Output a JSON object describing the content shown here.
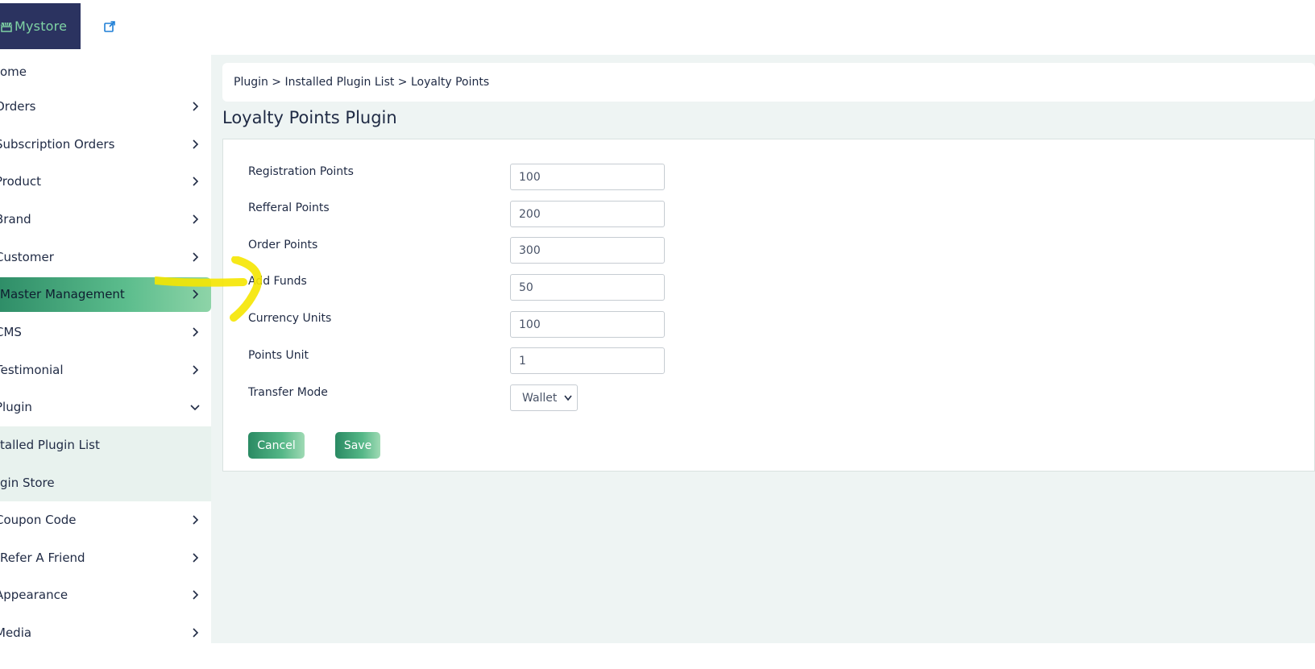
{
  "header": {
    "brand": "Mystore",
    "logo_icon": "store-icon",
    "external_link_icon": "external-link-icon"
  },
  "sidebar": {
    "items": [
      {
        "label": "ome",
        "chevron": false
      },
      {
        "label": "Orders",
        "chevron": true
      },
      {
        "label": "Subscription Orders",
        "chevron": true
      },
      {
        "label": "Product",
        "chevron": true
      },
      {
        "label": "Brand",
        "chevron": true
      },
      {
        "label": "Customer",
        "chevron": true
      },
      {
        "label": "Master Management",
        "chevron": true,
        "active": true
      },
      {
        "label": "CMS",
        "chevron": true
      },
      {
        "label": "Testimonial",
        "chevron": true
      },
      {
        "label": "Plugin",
        "chevron": "down"
      }
    ],
    "submenu": [
      {
        "label": "talled Plugin List"
      },
      {
        "label": "gin Store"
      }
    ],
    "items_after": [
      {
        "label": "Coupon Code",
        "chevron": true
      },
      {
        "label": "Refer A Friend",
        "chevron": true
      },
      {
        "label": "Appearance",
        "chevron": true
      },
      {
        "label": "Media",
        "chevron": true
      }
    ]
  },
  "breadcrumb": "Plugin > Installed Plugin List > Loyalty Points",
  "page_title": "Loyalty Points Plugin",
  "form": {
    "registration_points": {
      "label": "Registration Points",
      "value": "100"
    },
    "referral_points": {
      "label": "Refferal Points",
      "value": "200"
    },
    "order_points": {
      "label": "Order Points",
      "value": "300"
    },
    "add_funds": {
      "label": "Add Funds",
      "value": "50"
    },
    "currency_units": {
      "label": "Currency Units",
      "value": "100"
    },
    "points_unit": {
      "label": "Points Unit",
      "value": "1"
    },
    "transfer_mode": {
      "label": "Transfer Mode",
      "value": "Wallet"
    }
  },
  "buttons": {
    "cancel": "Cancel",
    "save": "Save"
  },
  "colors": {
    "sidebar_active": "#2f8e68",
    "brand_bg": "#2b3360",
    "brand_text": "#7fd3a4",
    "main_bg": "#eef4f3",
    "annotation": "#f5e600"
  }
}
